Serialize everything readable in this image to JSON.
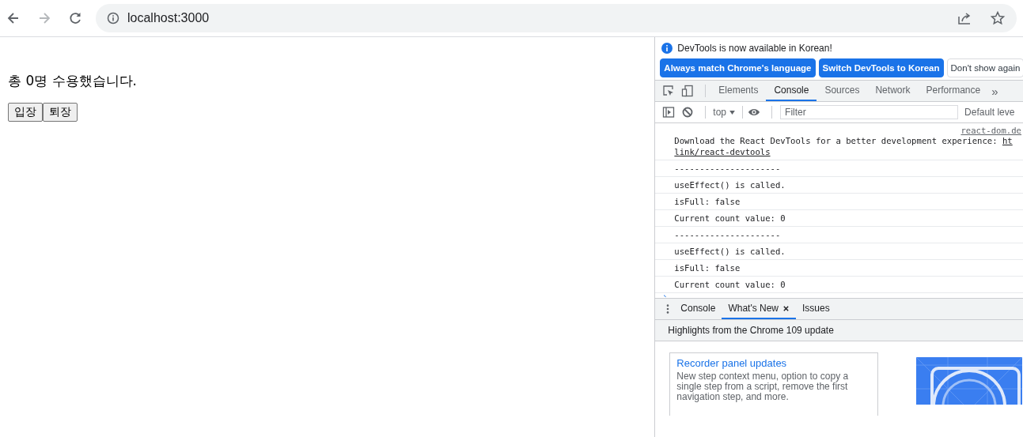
{
  "browser": {
    "address": "localhost:3000"
  },
  "page": {
    "message": "총 0명 수용했습니다.",
    "buttons": [
      "입장",
      "퇴장"
    ]
  },
  "devtools": {
    "infobar": {
      "text": "DevTools is now available in Korean!",
      "buttons": [
        {
          "label": "Always match Chrome's language",
          "kind": "primary"
        },
        {
          "label": "Switch DevTools to Korean",
          "kind": "primary"
        },
        {
          "label": "Don't show again",
          "kind": "plain"
        }
      ]
    },
    "tabs": [
      {
        "label": "Elements",
        "selected": false
      },
      {
        "label": "Console",
        "selected": true
      },
      {
        "label": "Sources",
        "selected": false
      },
      {
        "label": "Network",
        "selected": false
      },
      {
        "label": "Performance",
        "selected": false
      }
    ],
    "tabs_overflow": "»",
    "console_toolbar": {
      "context": "top",
      "filter_placeholder": "Filter",
      "levels": "Default leve"
    },
    "messages": [
      {
        "source": "react-dom.de",
        "text": "Download the React DevTools for a better development experience: ",
        "link_start": "ht",
        "link_rest": "link/react-devtools"
      },
      {
        "text": "---------------------"
      },
      {
        "text": "useEffect() is called."
      },
      {
        "text": "isFull: false"
      },
      {
        "text": "Current count value: 0"
      },
      {
        "text": "---------------------"
      },
      {
        "text": "useEffect() is called."
      },
      {
        "text": "isFull: false"
      },
      {
        "text": "Current count value: 0"
      }
    ],
    "drawer_tabs": [
      {
        "label": "Console",
        "selected": false,
        "closable": false
      },
      {
        "label": "What's New",
        "selected": true,
        "closable": true
      },
      {
        "label": "Issues",
        "selected": false,
        "closable": false
      }
    ],
    "whats_new": {
      "heading": "Highlights from the Chrome 109 update",
      "card": {
        "title": "Recorder panel updates",
        "text": "New step context menu, option to copy a single step from a script, remove the first navigation step, and more."
      }
    }
  }
}
